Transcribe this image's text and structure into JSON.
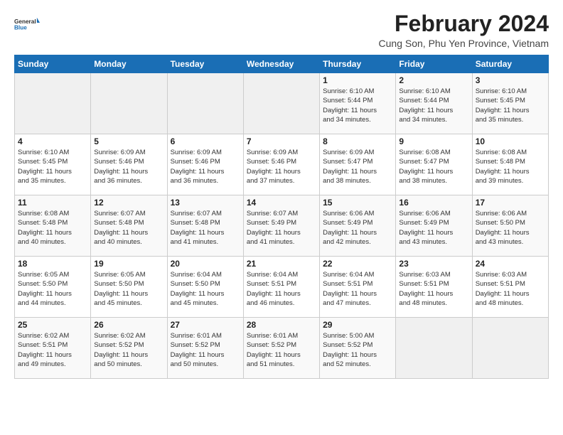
{
  "logo": {
    "general": "General",
    "blue": "Blue"
  },
  "title": "February 2024",
  "subtitle": "Cung Son, Phu Yen Province, Vietnam",
  "header": {
    "days": [
      "Sunday",
      "Monday",
      "Tuesday",
      "Wednesday",
      "Thursday",
      "Friday",
      "Saturday"
    ]
  },
  "weeks": [
    [
      {
        "day": "",
        "info": ""
      },
      {
        "day": "",
        "info": ""
      },
      {
        "day": "",
        "info": ""
      },
      {
        "day": "",
        "info": ""
      },
      {
        "day": "1",
        "info": "Sunrise: 6:10 AM\nSunset: 5:44 PM\nDaylight: 11 hours\nand 34 minutes."
      },
      {
        "day": "2",
        "info": "Sunrise: 6:10 AM\nSunset: 5:44 PM\nDaylight: 11 hours\nand 34 minutes."
      },
      {
        "day": "3",
        "info": "Sunrise: 6:10 AM\nSunset: 5:45 PM\nDaylight: 11 hours\nand 35 minutes."
      }
    ],
    [
      {
        "day": "4",
        "info": "Sunrise: 6:10 AM\nSunset: 5:45 PM\nDaylight: 11 hours\nand 35 minutes."
      },
      {
        "day": "5",
        "info": "Sunrise: 6:09 AM\nSunset: 5:46 PM\nDaylight: 11 hours\nand 36 minutes."
      },
      {
        "day": "6",
        "info": "Sunrise: 6:09 AM\nSunset: 5:46 PM\nDaylight: 11 hours\nand 36 minutes."
      },
      {
        "day": "7",
        "info": "Sunrise: 6:09 AM\nSunset: 5:46 PM\nDaylight: 11 hours\nand 37 minutes."
      },
      {
        "day": "8",
        "info": "Sunrise: 6:09 AM\nSunset: 5:47 PM\nDaylight: 11 hours\nand 38 minutes."
      },
      {
        "day": "9",
        "info": "Sunrise: 6:08 AM\nSunset: 5:47 PM\nDaylight: 11 hours\nand 38 minutes."
      },
      {
        "day": "10",
        "info": "Sunrise: 6:08 AM\nSunset: 5:48 PM\nDaylight: 11 hours\nand 39 minutes."
      }
    ],
    [
      {
        "day": "11",
        "info": "Sunrise: 6:08 AM\nSunset: 5:48 PM\nDaylight: 11 hours\nand 40 minutes."
      },
      {
        "day": "12",
        "info": "Sunrise: 6:07 AM\nSunset: 5:48 PM\nDaylight: 11 hours\nand 40 minutes."
      },
      {
        "day": "13",
        "info": "Sunrise: 6:07 AM\nSunset: 5:48 PM\nDaylight: 11 hours\nand 41 minutes."
      },
      {
        "day": "14",
        "info": "Sunrise: 6:07 AM\nSunset: 5:49 PM\nDaylight: 11 hours\nand 41 minutes."
      },
      {
        "day": "15",
        "info": "Sunrise: 6:06 AM\nSunset: 5:49 PM\nDaylight: 11 hours\nand 42 minutes."
      },
      {
        "day": "16",
        "info": "Sunrise: 6:06 AM\nSunset: 5:49 PM\nDaylight: 11 hours\nand 43 minutes."
      },
      {
        "day": "17",
        "info": "Sunrise: 6:06 AM\nSunset: 5:50 PM\nDaylight: 11 hours\nand 43 minutes."
      }
    ],
    [
      {
        "day": "18",
        "info": "Sunrise: 6:05 AM\nSunset: 5:50 PM\nDaylight: 11 hours\nand 44 minutes."
      },
      {
        "day": "19",
        "info": "Sunrise: 6:05 AM\nSunset: 5:50 PM\nDaylight: 11 hours\nand 45 minutes."
      },
      {
        "day": "20",
        "info": "Sunrise: 6:04 AM\nSunset: 5:50 PM\nDaylight: 11 hours\nand 45 minutes."
      },
      {
        "day": "21",
        "info": "Sunrise: 6:04 AM\nSunset: 5:51 PM\nDaylight: 11 hours\nand 46 minutes."
      },
      {
        "day": "22",
        "info": "Sunrise: 6:04 AM\nSunset: 5:51 PM\nDaylight: 11 hours\nand 47 minutes."
      },
      {
        "day": "23",
        "info": "Sunrise: 6:03 AM\nSunset: 5:51 PM\nDaylight: 11 hours\nand 48 minutes."
      },
      {
        "day": "24",
        "info": "Sunrise: 6:03 AM\nSunset: 5:51 PM\nDaylight: 11 hours\nand 48 minutes."
      }
    ],
    [
      {
        "day": "25",
        "info": "Sunrise: 6:02 AM\nSunset: 5:51 PM\nDaylight: 11 hours\nand 49 minutes."
      },
      {
        "day": "26",
        "info": "Sunrise: 6:02 AM\nSunset: 5:52 PM\nDaylight: 11 hours\nand 50 minutes."
      },
      {
        "day": "27",
        "info": "Sunrise: 6:01 AM\nSunset: 5:52 PM\nDaylight: 11 hours\nand 50 minutes."
      },
      {
        "day": "28",
        "info": "Sunrise: 6:01 AM\nSunset: 5:52 PM\nDaylight: 11 hours\nand 51 minutes."
      },
      {
        "day": "29",
        "info": "Sunrise: 5:00 AM\nSunset: 5:52 PM\nDaylight: 11 hours\nand 52 minutes."
      },
      {
        "day": "",
        "info": ""
      },
      {
        "day": "",
        "info": ""
      }
    ]
  ]
}
